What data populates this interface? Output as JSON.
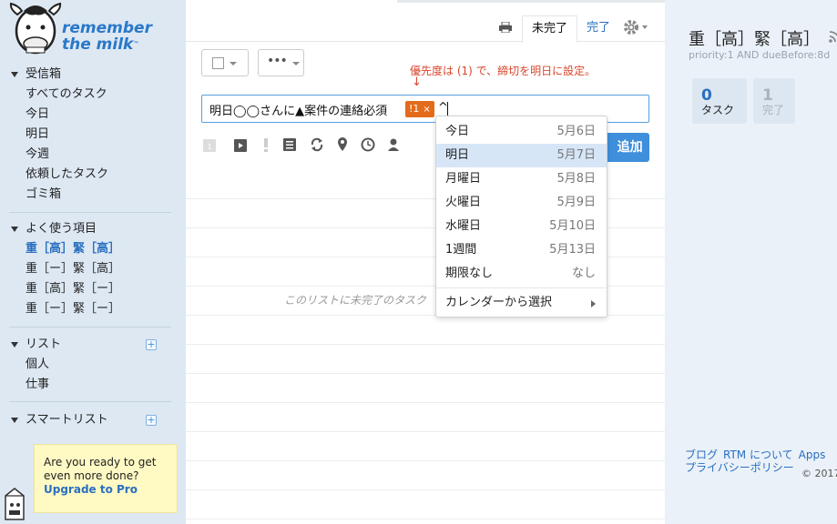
{
  "brand": {
    "line1": "remember",
    "line2": "the milk",
    "tm": "™"
  },
  "sidebar": {
    "inbox": {
      "title": "受信箱",
      "items": [
        "すべてのタスク",
        "今日",
        "明日",
        "今週",
        "依頼したタスク",
        "ゴミ箱"
      ]
    },
    "favorites": {
      "title": "よく使う項目",
      "items": [
        "重［高］緊［高］",
        "重［ー］緊［高］",
        "重［高］緊［ー］",
        "重［ー］緊［ー］"
      ],
      "active_index": 0
    },
    "lists": {
      "title": "リスト",
      "items": [
        "個人",
        "仕事"
      ]
    },
    "smartlists": {
      "title": "スマートリスト"
    },
    "plus_icon": "plus-icon"
  },
  "promo": {
    "text": "Are you ready to get even more done?",
    "link": "Upgrade to Pro"
  },
  "tabs": {
    "incomplete": "未完了",
    "complete": "完了"
  },
  "toolbar": {
    "more_label": "•••"
  },
  "annotation": {
    "text": "優先度は (1) で、締切を明日に設定。",
    "arrow": "↓"
  },
  "task_input": {
    "text": "明日◯◯さんに▲案件の連絡必須",
    "priority_chip": "!1",
    "chip_close": "×",
    "typed": "^"
  },
  "add_button": {
    "label": "追加"
  },
  "empty_message": "このリストに未完了のタスク",
  "due_dropdown": {
    "items": [
      {
        "label": "今日",
        "date": "5月6日"
      },
      {
        "label": "明日",
        "date": "5月7日"
      },
      {
        "label": "月曜日",
        "date": "5月8日"
      },
      {
        "label": "火曜日",
        "date": "5月9日"
      },
      {
        "label": "水曜日",
        "date": "5月10日"
      },
      {
        "label": "1週間",
        "date": "5月13日"
      },
      {
        "label": "期限なし",
        "date": "なし"
      }
    ],
    "highlighted_index": 1,
    "calendar": "カレンダーから選択"
  },
  "right_panel": {
    "title": "重［高］緊［高］",
    "filter": "priority:1 AND dueBefore:8d",
    "stats": [
      {
        "count": "0",
        "label": "タスク"
      },
      {
        "count": "1",
        "label": "完了"
      }
    ],
    "footer": [
      "ブログ",
      "RTM について",
      "Apps",
      "プライバシーポリシー"
    ],
    "copyright": "© 2017"
  },
  "colors": {
    "accent": "#2a6fc0",
    "sidebar_bg": "#dde8f3",
    "priority_chip": "#e36c1c",
    "annotation": "#d9452b",
    "add_button": "#3f8fdc"
  }
}
